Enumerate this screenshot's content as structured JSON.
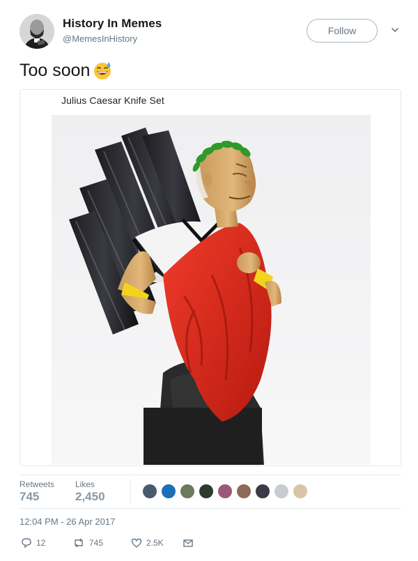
{
  "author": {
    "name": "History In Memes",
    "handle": "@MemesInHistory"
  },
  "follow_label": "Follow",
  "tweet_text": "Too soon",
  "emoji_icon": "grinning-face-with-sweat",
  "media": {
    "caption": "Julius Caesar Knife Set"
  },
  "stats": {
    "retweets_label": "Retweets",
    "retweets_value": "745",
    "likes_label": "Likes",
    "likes_value": "2,450"
  },
  "liker_avatars": [
    "#4a5a6e",
    "#1d6fb5",
    "#6b7a5a",
    "#2e3a2e",
    "#9a5a7a",
    "#8a6a5a",
    "#3a3a48",
    "#c8ccd1",
    "#d9c4a8"
  ],
  "timestamp": "12:04 PM - 26 Apr 2017",
  "actions": {
    "reply_count": "12",
    "retweet_count": "745",
    "like_count": "2.5K"
  },
  "colors": {
    "text": "#14171a",
    "secondary": "#657786",
    "border": "#e1e8ed"
  }
}
